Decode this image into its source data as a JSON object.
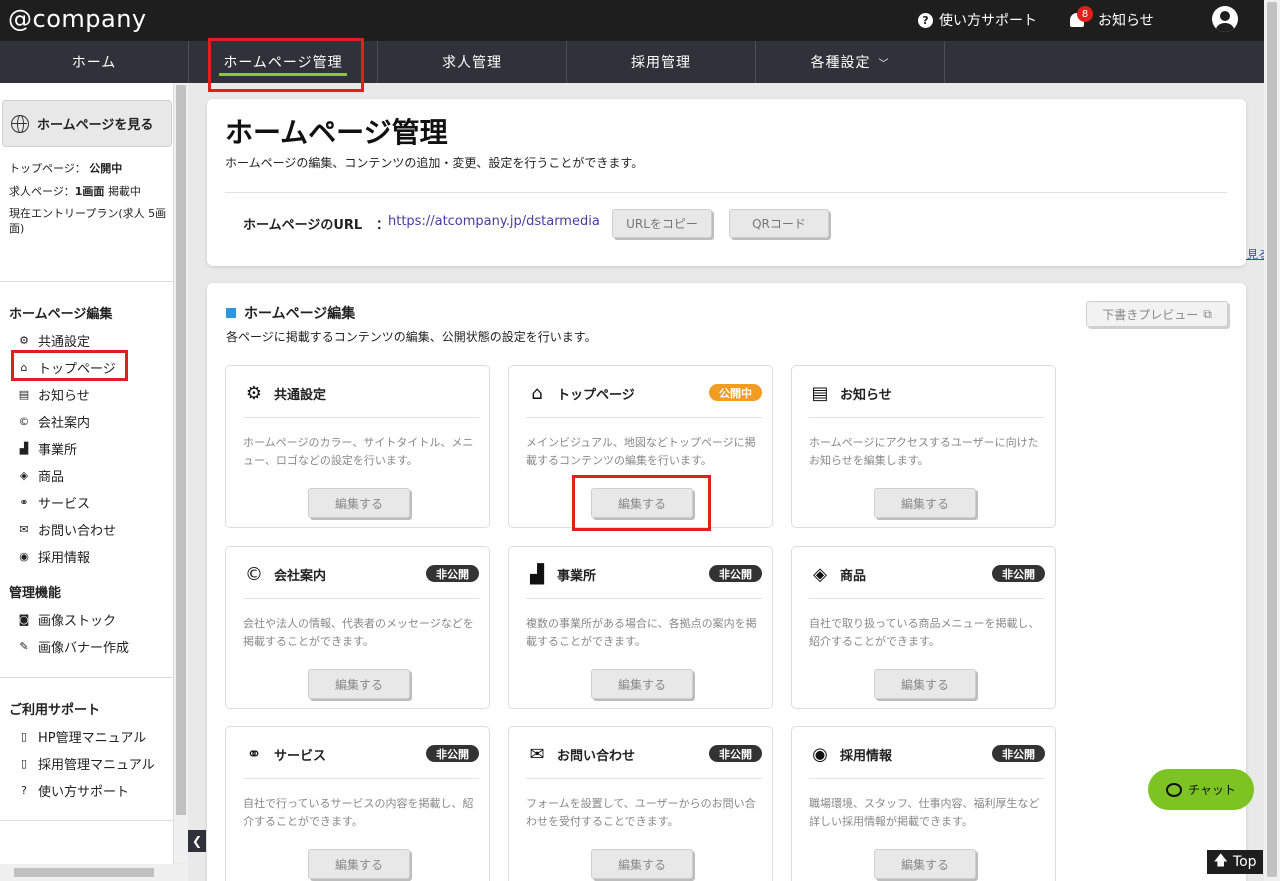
{
  "header": {
    "logo": "@company",
    "help_label": "使い方サポート",
    "notice_label": "お知らせ",
    "notice_count": "8"
  },
  "nav": {
    "tabs": [
      {
        "label": "ホーム"
      },
      {
        "label": "ホームページ管理",
        "active": true
      },
      {
        "label": "求人管理"
      },
      {
        "label": "採用管理"
      },
      {
        "label": "各種設定"
      }
    ]
  },
  "sidebar": {
    "view_hp_label": "ホームページを見る",
    "top_status": "トップページ：",
    "top_status_val": "公開中",
    "job_pages": "求人ページ：",
    "job_pages_val": "1画面",
    "job_pages_suffix": "掲載中",
    "plan": "現在エントリープラン(求人 5画面)",
    "other_plan_link": "別のプランを見る",
    "hp_edit_heading": "ホームページ編集",
    "hp_edit_items": [
      {
        "label": "共通設定",
        "icon": "gear-icon"
      },
      {
        "label": "トップページ",
        "icon": "home-icon"
      },
      {
        "label": "お知らせ",
        "icon": "news-icon"
      },
      {
        "label": "会社案内",
        "icon": "copyright-icon"
      },
      {
        "label": "事業所",
        "icon": "factory-icon"
      },
      {
        "label": "商品",
        "icon": "box-icon"
      },
      {
        "label": "サービス",
        "icon": "handshake-icon"
      },
      {
        "label": "お問い合わせ",
        "icon": "envelope-icon"
      },
      {
        "label": "採用情報",
        "icon": "user-circle-icon"
      }
    ],
    "admin_heading": "管理機能",
    "admin_items": [
      {
        "label": "画像ストック",
        "icon": "camera-icon"
      },
      {
        "label": "画像バナー作成",
        "icon": "pencil-icon"
      }
    ],
    "support_heading": "ご利用サポート",
    "support_items": [
      {
        "label": "HP管理マニュアル",
        "icon": "pdf-icon"
      },
      {
        "label": "採用管理マニュアル",
        "icon": "pdf-icon"
      },
      {
        "label": "使い方サポート",
        "icon": "help-icon"
      }
    ]
  },
  "main": {
    "title": "ホームページ管理",
    "description": "ホームページの編集、コンテンツの追加・変更、設定を行うことができます。",
    "url_label": "ホームページのURL",
    "url_colon": "：",
    "url_value": "https://atcompany.jp/dstarmedia",
    "copy_url_label": "URLをコピー",
    "qr_label": "QRコード"
  },
  "hp_edit": {
    "title": "ホームページ編集",
    "description": "各ページに掲載するコンテンツの編集、公開状態の設定を行います。",
    "preview_label": "下書きプレビュー",
    "edit_label": "編集する",
    "tiles": [
      {
        "title": "共通設定",
        "icon": "gear-icon",
        "badge": "",
        "desc": "ホームページのカラー、サイトタイトル、メニュー、ロゴなどの設定を行います。"
      },
      {
        "title": "トップページ",
        "icon": "home-icon",
        "badge": "公開中",
        "badge_color": "#f39c22",
        "desc": "メインビジュアル、地図などトップページに掲載するコンテンツの編集を行います。"
      },
      {
        "title": "お知らせ",
        "icon": "news-icon",
        "badge": "",
        "desc": "ホームページにアクセスするユーザーに向けたお知らせを編集します。"
      },
      {
        "title": "会社案内",
        "icon": "copyright-icon",
        "badge": "非公開",
        "badge_color": "#333333",
        "desc": "会社や法人の情報、代表者のメッセージなどを掲載することができます。"
      },
      {
        "title": "事業所",
        "icon": "factory-icon",
        "badge": "非公開",
        "badge_color": "#333333",
        "desc": "複数の事業所がある場合に、各拠点の案内を掲載することができます。"
      },
      {
        "title": "商品",
        "icon": "box-icon",
        "badge": "非公開",
        "badge_color": "#333333",
        "desc": "自社で取り扱っている商品メニューを掲載し、紹介することができます。"
      },
      {
        "title": "サービス",
        "icon": "handshake-icon",
        "badge": "非公開",
        "badge_color": "#333333",
        "desc": "自社で行っているサービスの内容を掲載し、紹介することができます。"
      },
      {
        "title": "お問い合わせ",
        "icon": "envelope-icon",
        "badge": "非公開",
        "badge_color": "#333333",
        "desc": "フォームを設置して、ユーザーからのお問い合わせを受付することできます。"
      },
      {
        "title": "採用情報",
        "icon": "user-circle-icon",
        "badge": "非公開",
        "badge_color": "#333333",
        "desc": "職場環境、スタッフ、仕事内容、福利厚生など詳しい採用情報が掲載できます。"
      }
    ]
  },
  "floating": {
    "chat_label": "チャット",
    "top_label": "Top"
  }
}
